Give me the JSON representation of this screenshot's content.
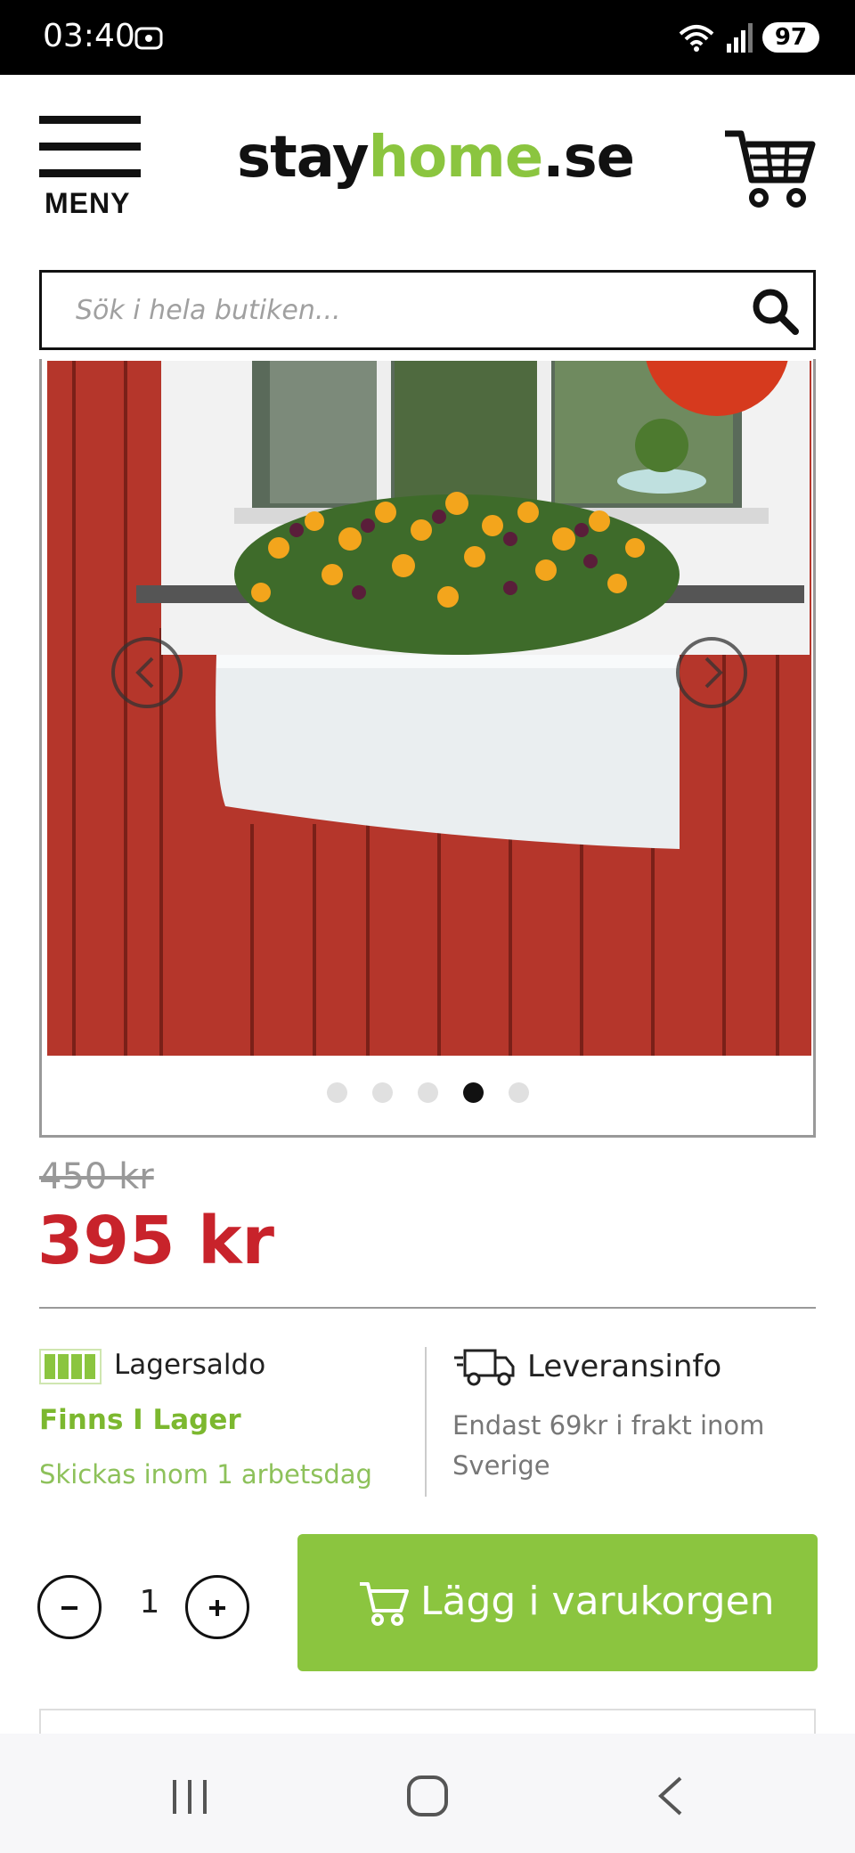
{
  "status_bar": {
    "time": "03:40",
    "battery": "97"
  },
  "header": {
    "menu_label": "MENY",
    "logo": {
      "part1": "stay",
      "part2": "home",
      "part3": ".se"
    }
  },
  "search": {
    "placeholder": "Sök i hela butiken..."
  },
  "gallery": {
    "image_description": "White window box planter with yellow and purple pansies mounted under a window on a red wooden wall",
    "slide_count": 5,
    "active_slide": 4
  },
  "price": {
    "old": "450 kr",
    "current": "395 kr"
  },
  "stock": {
    "title": "Lagersaldo",
    "status": "Finns I Lager",
    "shipping": "Skickas inom 1 arbetsdag"
  },
  "delivery": {
    "title": "Leveransinfo",
    "text": "Endast 69kr i frakt inom Sverige"
  },
  "cart_form": {
    "quantity": "1",
    "add_label": "Lägg i varukorgen"
  },
  "colors": {
    "brand_green": "#8bc53f",
    "price_red": "#c8232b",
    "text_dark": "#222222"
  }
}
